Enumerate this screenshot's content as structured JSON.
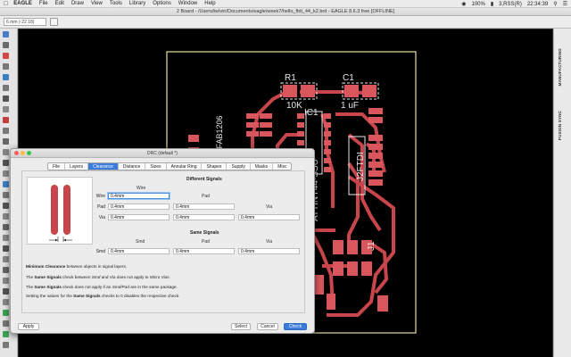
{
  "menubar": {
    "app_name": "EAGLE",
    "items": [
      "File",
      "Edit",
      "Draw",
      "View",
      "Tools",
      "Library",
      "Options",
      "Window",
      "Help"
    ],
    "battery": "100%",
    "user": "3,RSS(R)",
    "clock": "22:34:39"
  },
  "window": {
    "title": "2 Board - /Users/kelvin/Documents/eagle/week7/hello_ftdi_44_k2.brd - EAGLE 8.6.3 free [OFFLINE]"
  },
  "toolbar": {
    "coordinate": "6 mm (-22 18)"
  },
  "right_panel": {
    "labels": [
      "MANUFACTURING",
      "FUSION SYNC"
    ]
  },
  "board": {
    "labels": {
      "r1": "R1",
      "r1_value": "10K",
      "c1": "C1",
      "c1_value": "1 uF",
      "ic_top": "IC1",
      "ic_name": "ATTINY44-SSU",
      "ftdi": "J2FTDI",
      "j1": "J1",
      "led": "DFAB1206"
    },
    "colors": {
      "board_outline": "#e7e1a0",
      "copper_top": "#c8464b",
      "pad": "#d9575c",
      "silkscreen": "#e8e8e8",
      "background": "#000000"
    }
  },
  "dialog": {
    "title": "DRC (default *)",
    "tabs": [
      "File",
      "Layers",
      "Clearance",
      "Distance",
      "Sizes",
      "Annular Ring",
      "Shapes",
      "Supply",
      "Masks",
      "Misc"
    ],
    "active_tab": "Clearance",
    "different_signals": {
      "title": "Different Signals",
      "columns": [
        "Wire",
        "Pad",
        "Via"
      ],
      "rows": [
        {
          "label": "Wire",
          "values": [
            "0.4mm"
          ]
        },
        {
          "label": "Pad",
          "values": [
            "0.4mm",
            "0.4mm"
          ]
        },
        {
          "label": "Via",
          "values": [
            "0.4mm",
            "0.4mm",
            "0.4mm"
          ]
        }
      ]
    },
    "same_signals": {
      "title": "Same Signals",
      "columns": [
        "Smd",
        "Pad",
        "Via"
      ],
      "row_label": "Smd",
      "values": [
        "0.4mm",
        "0.4mm",
        "0.4mm"
      ]
    },
    "notes": {
      "n1_bold": "Minimum Clearance",
      "n1_rest": " between objects in signal layers.",
      "n2_a": "The ",
      "n2_bold": "Same Signals",
      "n2_b": " check between ",
      "n2_i1": "Smd",
      "n2_c": " and ",
      "n2_i2": "Via",
      "n2_d": " does not apply to ",
      "n2_i3": "Micro Vias",
      "n2_e": ".",
      "n3_a": "The ",
      "n3_bold": "Same Signals",
      "n3_b": " check does not apply if an ",
      "n3_i": "Smd/Pad",
      "n3_c": " are in the same package.",
      "n4_a": "Setting the values for the ",
      "n4_bold": "Same Signals",
      "n4_b": " checks to 0 disables the respective check."
    },
    "buttons": {
      "apply": "Apply",
      "select": "Select",
      "cancel": "Cancel",
      "check": "Check"
    }
  }
}
